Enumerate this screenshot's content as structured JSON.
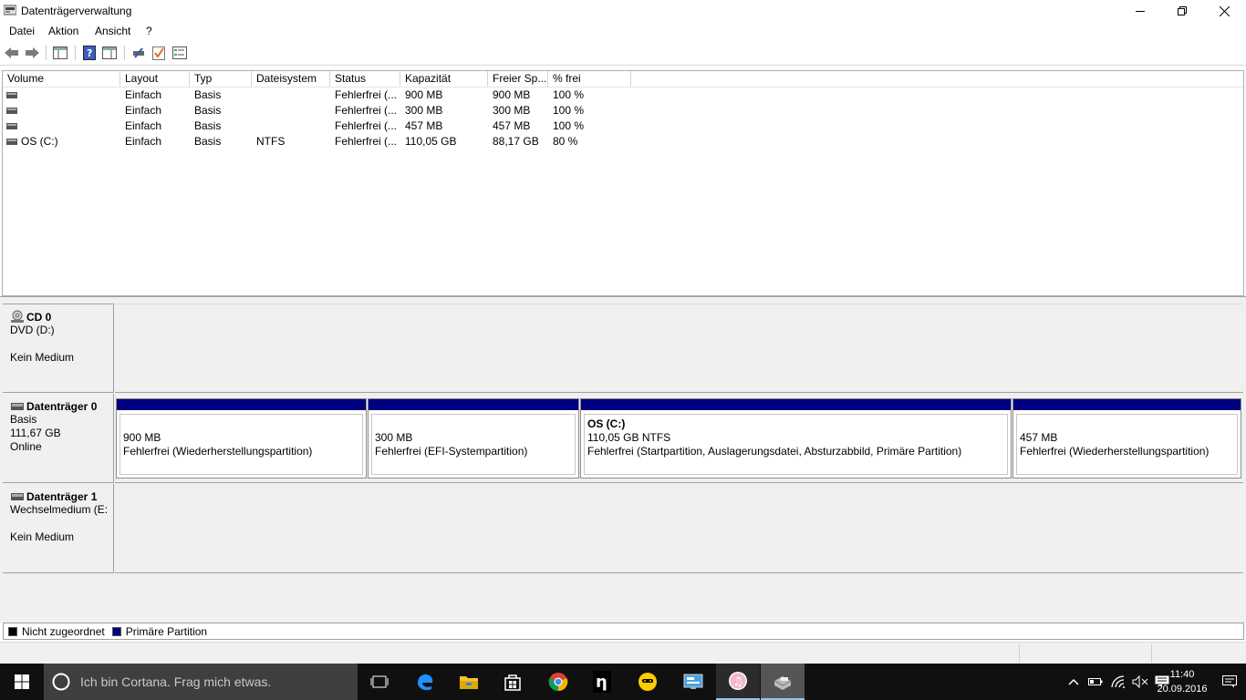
{
  "window": {
    "title": "Datenträgerverwaltung"
  },
  "menu": {
    "items": [
      "Datei",
      "Aktion",
      "Ansicht",
      "?"
    ]
  },
  "volume_table": {
    "columns": [
      "Volume",
      "Layout",
      "Typ",
      "Dateisystem",
      "Status",
      "Kapazität",
      "Freier Sp...",
      "% frei"
    ],
    "rows": [
      {
        "volume": "",
        "layout": "Einfach",
        "typ": "Basis",
        "dateisystem": "",
        "status": "Fehlerfrei (...",
        "kapazitaet": "900 MB",
        "frei": "900 MB",
        "prozent": "100 %"
      },
      {
        "volume": "",
        "layout": "Einfach",
        "typ": "Basis",
        "dateisystem": "",
        "status": "Fehlerfrei (...",
        "kapazitaet": "300 MB",
        "frei": "300 MB",
        "prozent": "100 %"
      },
      {
        "volume": "",
        "layout": "Einfach",
        "typ": "Basis",
        "dateisystem": "",
        "status": "Fehlerfrei (...",
        "kapazitaet": "457 MB",
        "frei": "457 MB",
        "prozent": "100 %"
      },
      {
        "volume": "OS (C:)",
        "layout": "Einfach",
        "typ": "Basis",
        "dateisystem": "NTFS",
        "status": "Fehlerfrei (...",
        "kapazitaet": "110,05 GB",
        "frei": "88,17 GB",
        "prozent": "80 %"
      }
    ]
  },
  "disks": {
    "cd0": {
      "name": "CD 0",
      "line1": "DVD (D:)",
      "line2": "Kein Medium"
    },
    "disk0": {
      "name": "Datenträger 0",
      "line1": "Basis",
      "line2": "111,67 GB",
      "line3": "Online",
      "partitions": [
        {
          "title": "",
          "size": "900 MB",
          "status": "Fehlerfrei (Wiederherstellungspartition)"
        },
        {
          "title": "",
          "size": "300 MB",
          "status": "Fehlerfrei (EFI-Systempartition)"
        },
        {
          "title": "OS  (C:)",
          "size": "110,05 GB NTFS",
          "status": "Fehlerfrei (Startpartition, Auslagerungsdatei, Absturzabbild, Primäre Partition)"
        },
        {
          "title": "",
          "size": "457 MB",
          "status": "Fehlerfrei (Wiederherstellungspartition)"
        }
      ]
    },
    "disk1": {
      "name": "Datenträger 1",
      "line1": "Wechselmedium (E:",
      "line2": "Kein Medium"
    }
  },
  "legend": {
    "unallocated": {
      "label": "Nicht zugeordnet",
      "color": "#000000"
    },
    "primary": {
      "label": "Primäre Partition",
      "color": "#000080"
    }
  },
  "taskbar": {
    "search_placeholder": "Ich bin Cortana. Frag mich etwas.",
    "apps": [
      "task-view-icon",
      "edge-icon",
      "file-explorer-icon",
      "store-icon",
      "chrome-icon",
      "n-app-icon",
      "cyberghost-icon",
      "control-panel-icon",
      "itunes-icon",
      "disk-management-icon"
    ],
    "clock_time": "11:40",
    "clock_date": "20.09.2016"
  },
  "colors": {
    "accent_bar": "#000080",
    "taskbar_bg": "#101010",
    "search_bg": "#3f3f3f"
  }
}
